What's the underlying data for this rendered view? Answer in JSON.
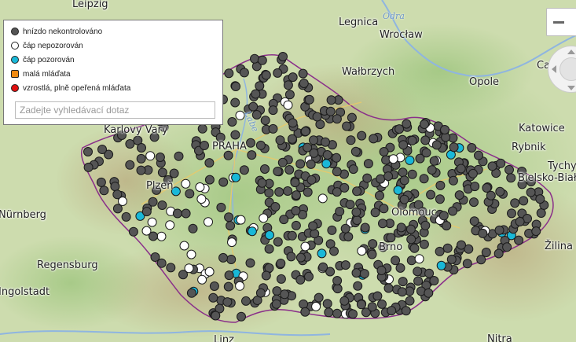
{
  "legend": {
    "items": [
      {
        "label": "hnízdo nekontrolováno",
        "color": "#555555"
      },
      {
        "label": "čáp nepozorován",
        "color": "#ffffff"
      },
      {
        "label": "čáp pozorován",
        "color": "#19b8d8"
      },
      {
        "label": "malá mláďata",
        "color": "#f08a12"
      },
      {
        "label": "vzrostlá, plně opeřená mláďata",
        "color": "#e01010"
      }
    ],
    "search_placeholder": "Zadejte vyhledávací dotaz"
  },
  "map": {
    "cities": [
      "Leipzig",
      "Legnica",
      "Wrocław",
      "Wałbrzych",
      "Opole",
      "Katowice",
      "Rybnik",
      "Tychy",
      "Bielsko-Biała",
      "Žilina",
      "Regensburg",
      "Brno",
      "Olomouc",
      "PRAHA",
      "Karlovy Vary",
      "Plzeň",
      "Ingolstadt",
      "Nitra",
      "Linz",
      "Nürnberg",
      "Ca"
    ],
    "rivers": [
      "Odra",
      "Labe"
    ],
    "colors": {
      "unchecked": "#555555",
      "not_observed": "#ffffff",
      "observed": "#19b8d8",
      "border": "#8a2f8a"
    }
  },
  "controls": {
    "zoom_out_icon": "minus-icon",
    "pan_icon": "pan-control-icon"
  }
}
